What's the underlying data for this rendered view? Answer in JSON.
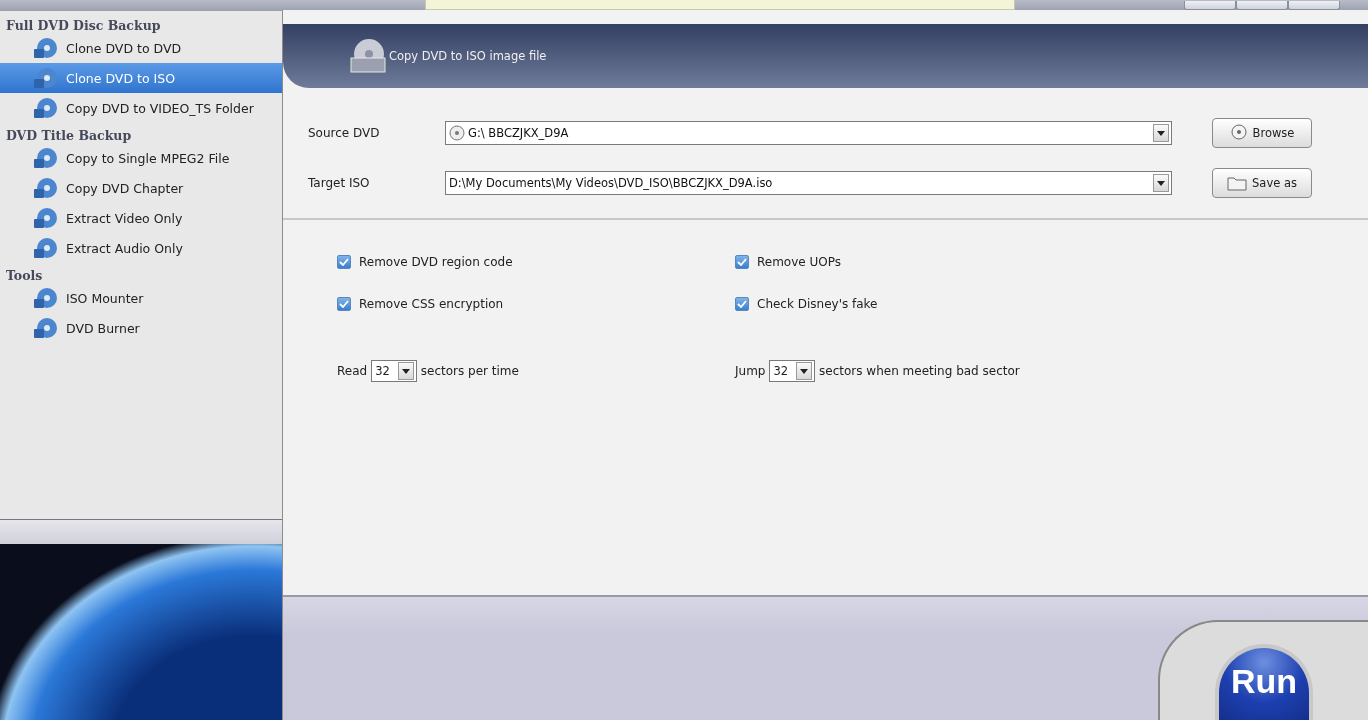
{
  "sidebar": {
    "groups": [
      {
        "title": "Full DVD Disc Backup",
        "items": [
          {
            "label": "Clone DVD to DVD",
            "selected": false
          },
          {
            "label": "Clone DVD to ISO",
            "selected": true
          },
          {
            "label": "Copy DVD to VIDEO_TS Folder",
            "selected": false
          }
        ]
      },
      {
        "title": "DVD Title Backup",
        "items": [
          {
            "label": "Copy to Single MPEG2 File",
            "selected": false
          },
          {
            "label": "Copy DVD Chapter",
            "selected": false
          },
          {
            "label": "Extract Video Only",
            "selected": false
          },
          {
            "label": "Extract Audio Only",
            "selected": false
          }
        ]
      },
      {
        "title": "Tools",
        "items": [
          {
            "label": "ISO Mounter",
            "selected": false
          },
          {
            "label": "DVD Burner",
            "selected": false
          }
        ]
      }
    ]
  },
  "header": {
    "title": "Copy DVD to ISO image file"
  },
  "fields": [
    {
      "label": "Source DVD",
      "value": "G:\\ BBCZJKX_D9A",
      "kind": "disc",
      "button": "Browse"
    },
    {
      "label": "Target ISO",
      "value": "D:\\My Documents\\My Videos\\DVD_ISO\\BBCZJKX_D9A.iso",
      "kind": "file",
      "button": "Save as"
    }
  ],
  "options": [
    {
      "label": "Remove DVD region code",
      "checked": true
    },
    {
      "label": "Remove UOPs",
      "checked": true
    },
    {
      "label": "Remove CSS encryption",
      "checked": true
    },
    {
      "label": "Check Disney's fake",
      "checked": true
    }
  ],
  "sector_settings": [
    {
      "before": "Read",
      "value": "32",
      "after": "sectors per time"
    },
    {
      "before": "Jump",
      "value": "32",
      "after": "sectors when meeting bad sector"
    }
  ],
  "run_button": "Run"
}
